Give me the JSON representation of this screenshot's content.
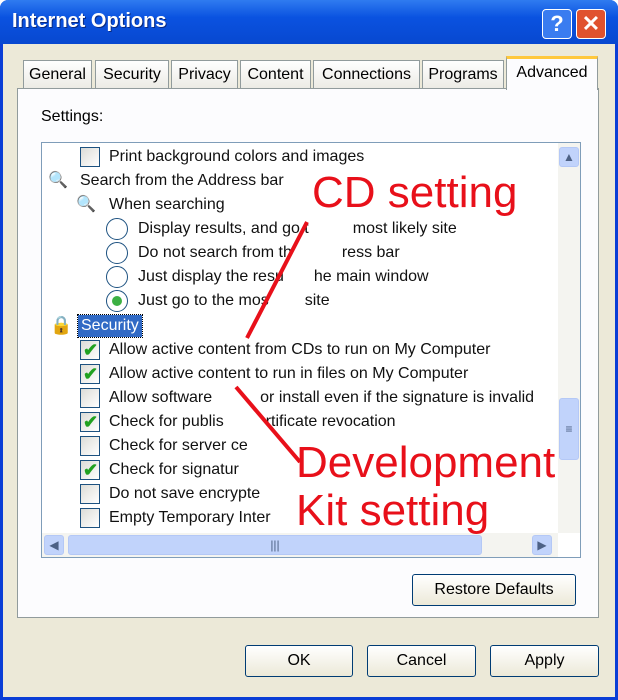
{
  "window": {
    "title": "Internet Options",
    "help": "?",
    "close": "✕"
  },
  "tabs": [
    "General",
    "Security",
    "Privacy",
    "Content",
    "Connections",
    "Programs",
    "Advanced"
  ],
  "settings_label": "Settings:",
  "items": {
    "print_bg": "Print background colors and images",
    "search_bar": "Search from the Address bar",
    "when_searching": "When searching",
    "r1a": "Display results, and go t",
    "r1b": "most likely site",
    "r2a": "Do not search from th",
    "r2b": "ress bar",
    "r3a": "Just display the resu",
    "r3b": "he main window",
    "r4a": "Just go to the mos",
    "r4b": "site",
    "security": "Security",
    "c1": "Allow active content from CDs to run on My Computer",
    "c2": "Allow active content to run in files on My Computer",
    "c3a": "Allow software",
    "c3b": "or install even if the signature is invalid",
    "c4a": "Check for publis",
    "c4b": "rtificate revocation",
    "c5": "Check for server ce",
    "c6": "Check for signatur",
    "c7": "Do not save encrypte",
    "c8": "Empty Temporary Inter"
  },
  "checked": {
    "c1": true,
    "c2": true,
    "c3": false,
    "c4": true,
    "c5": false,
    "c6": true,
    "c7": false,
    "c8": false
  },
  "radio_selected": "r4",
  "buttons": {
    "restore": "Restore Defaults",
    "ok": "OK",
    "cancel": "Cancel",
    "apply": "Apply"
  },
  "annotations": {
    "cd": "CD setting",
    "dev1": "Development",
    "dev2": "Kit setting",
    "color": "#e8101a"
  }
}
